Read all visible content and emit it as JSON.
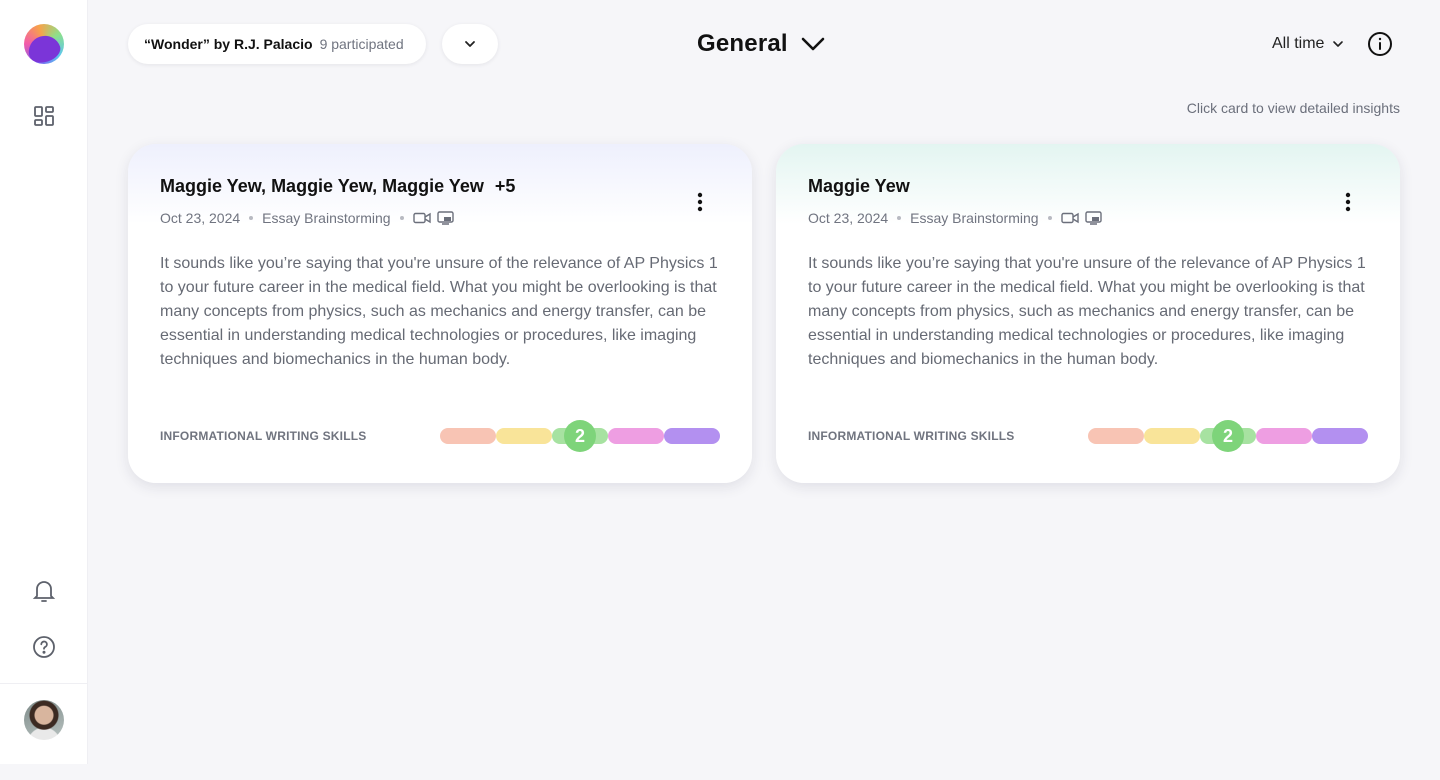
{
  "book": {
    "title": "“Wonder” by R.J. Palacio",
    "participated": "9 participated"
  },
  "header": {
    "title": "General",
    "filter": "All time"
  },
  "hint": "Click card to view detailed insights",
  "sidebar": {
    "icons": [
      "app-logo",
      "dashboard-icon",
      "bell-icon",
      "help-icon",
      "avatar"
    ]
  },
  "colors": {
    "segments": [
      "#f8c4b4",
      "#f9e499",
      "#a7e2a1",
      "#ee9ee2",
      "#b390f0"
    ],
    "bubble": "#7ed47a"
  },
  "cards": [
    {
      "names": [
        "Maggie Yew,",
        "Maggie Yew,",
        "Maggie Yew"
      ],
      "extra": "+5",
      "date": "Oct 23, 2024",
      "type": "Essay Brainstorming",
      "text": "It sounds like you’re saying that you're unsure of the relevance of AP Physics 1 to your future career in the medical field. What you might be overlooking is that many concepts from physics, such as mechanics and energy transfer, can be essential in understanding medical technologies or procedures, like imaging techniques and biomechanics in the human body.",
      "skill": "INFORMATIONAL WRITING SKILLS",
      "level": "2"
    },
    {
      "names": [
        "Maggie Yew"
      ],
      "extra": "",
      "date": "Oct 23, 2024",
      "type": "Essay Brainstorming",
      "text": "It sounds like you’re saying that you're unsure of the relevance of AP Physics 1 to your future career in the medical field. What you might be overlooking is that many concepts from physics, such as mechanics and energy transfer, can be essential in understanding medical technologies or procedures, like imaging techniques and biomechanics in the human body.",
      "skill": "INFORMATIONAL WRITING SKILLS",
      "level": "2"
    }
  ]
}
